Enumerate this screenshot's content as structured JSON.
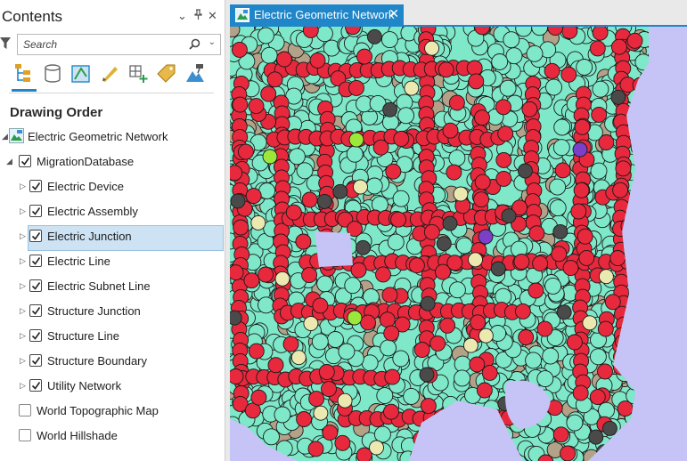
{
  "contents": {
    "title": "Contents",
    "controls": [
      "⌄",
      "⊥",
      "✕"
    ],
    "search": {
      "placeholder": "Search",
      "value": ""
    },
    "toolbar_icons": [
      "list-by-drawing-order-icon",
      "list-by-data-source-icon",
      "list-by-selection-icon",
      "list-by-editing-icon",
      "list-by-snapping-icon",
      "list-by-labeling-icon",
      "list-by-perspective-imagery-icon"
    ],
    "heading": "Drawing Order",
    "tree": [
      {
        "label": "Electric Geometric Network",
        "level": 0,
        "expander": "expanded",
        "checkbox": false,
        "icon": "map-icon"
      },
      {
        "label": "MigrationDatabase",
        "level": 1,
        "expander": "expanded",
        "checkbox": true,
        "checked": true
      },
      {
        "label": "Electric Device",
        "level": 2,
        "expander": "collapsed",
        "checkbox": true,
        "checked": true
      },
      {
        "label": "Electric Assembly",
        "level": 2,
        "expander": "collapsed",
        "checkbox": true,
        "checked": true
      },
      {
        "label": "Electric Junction",
        "level": 2,
        "expander": "collapsed",
        "checkbox": true,
        "checked": true,
        "selected": true
      },
      {
        "label": "Electric Line",
        "level": 2,
        "expander": "collapsed",
        "checkbox": true,
        "checked": true
      },
      {
        "label": "Electric Subnet Line",
        "level": 2,
        "expander": "collapsed",
        "checkbox": true,
        "checked": true
      },
      {
        "label": "Structure Junction",
        "level": 2,
        "expander": "collapsed",
        "checkbox": true,
        "checked": true
      },
      {
        "label": "Structure Line",
        "level": 2,
        "expander": "collapsed",
        "checkbox": true,
        "checked": true
      },
      {
        "label": "Structure Boundary",
        "level": 2,
        "expander": "collapsed",
        "checkbox": true,
        "checked": true
      },
      {
        "label": "Utility Network",
        "level": 2,
        "expander": "collapsed",
        "checkbox": true,
        "checked": true
      },
      {
        "label": "World Topographic Map",
        "level": 1,
        "expander": "none",
        "checkbox": true,
        "checked": false
      },
      {
        "label": "World Hillshade",
        "level": 1,
        "expander": "none",
        "checkbox": true,
        "checked": false
      }
    ]
  },
  "map_tab": {
    "label": "Electric Geometric Network",
    "close": "✕"
  },
  "colors": {
    "accent": "#1f86c9",
    "map_background": "#c6c4f7",
    "junction_teal": "#7ee8c8",
    "device_red": "#e8283c",
    "structure_tan": "#b3a288",
    "dark_grey": "#4a4a4a",
    "cream": "#ece9b0",
    "lime": "#9be83a",
    "purple": "#7b3fc8",
    "selection": "#cde3f4"
  }
}
